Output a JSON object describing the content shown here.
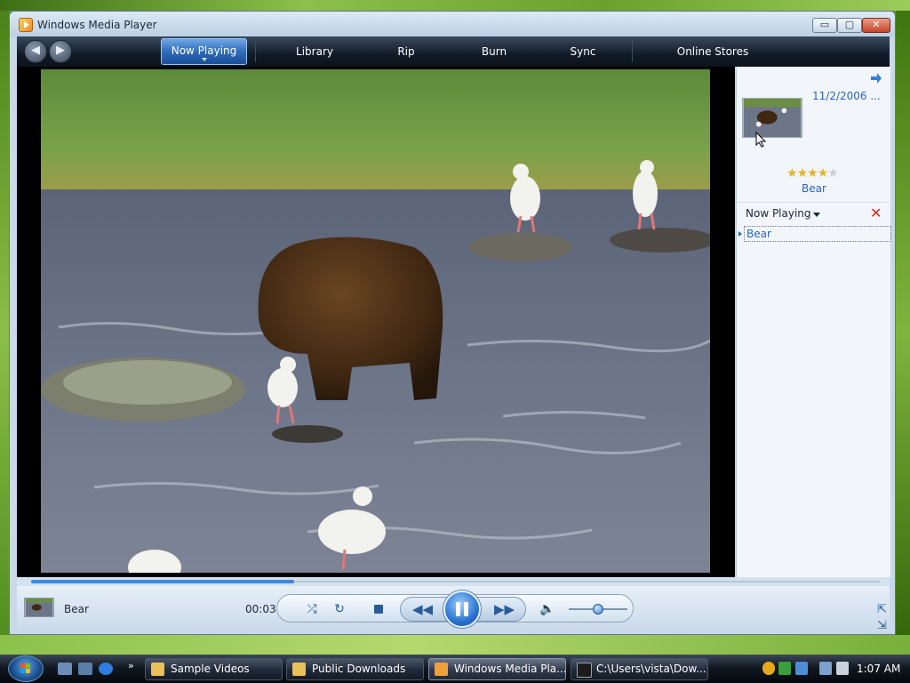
{
  "window": {
    "title": "Windows Media Player",
    "buttons": {
      "minimize": "▭",
      "maximize": "▢",
      "close": "✕"
    }
  },
  "nav": {
    "back_icon": "back-arrow-icon",
    "forward_icon": "forward-arrow-icon",
    "tabs": [
      {
        "label": "Now Playing",
        "active": true
      },
      {
        "label": "Library",
        "active": false
      },
      {
        "label": "Rip",
        "active": false
      },
      {
        "label": "Burn",
        "active": false
      },
      {
        "label": "Sync",
        "active": false
      },
      {
        "label": "Online Stores",
        "active": false
      }
    ]
  },
  "side_panel": {
    "date": "11/2/2006 ...",
    "rating_stars_filled": 4,
    "rating_stars_total": 5,
    "media_title": "Bear",
    "list_label": "Now Playing",
    "playlist": [
      {
        "title": "Bear",
        "selected": true
      }
    ]
  },
  "controls": {
    "current_title": "Bear",
    "elapsed": "00:03",
    "progress_fraction": 0.31,
    "volume_fraction": 0.5,
    "state": "playing"
  },
  "taskbar": {
    "tasks": [
      {
        "label": "Sample Videos",
        "icon": "folder-icon",
        "active": false
      },
      {
        "label": "Public Downloads",
        "icon": "folder-icon",
        "active": false
      },
      {
        "label": "Windows Media Pla...",
        "icon": "media-player-icon",
        "active": true
      },
      {
        "label": "C:\\Users\\vista\\Dow...",
        "icon": "command-prompt-icon",
        "active": false
      }
    ],
    "clock": "1:07 AM"
  },
  "colors": {
    "accent_blue": "#2a64c6",
    "nav_dark": "#111b28",
    "desktop_green": "#7fb53c",
    "close_red": "#c8452a"
  }
}
